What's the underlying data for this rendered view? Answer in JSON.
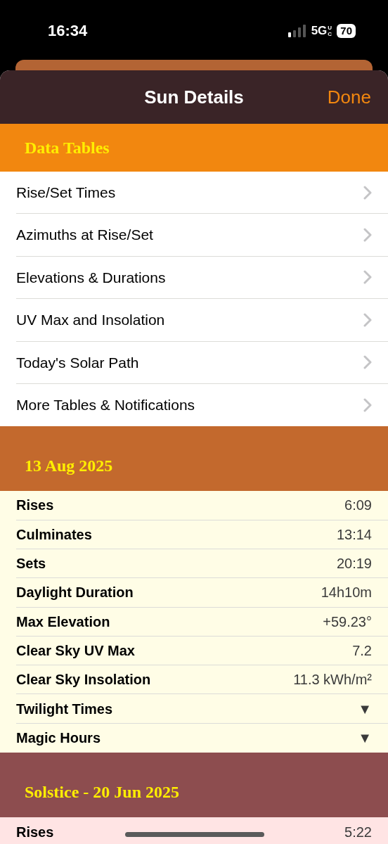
{
  "status_bar": {
    "time": "16:34",
    "network": "5G",
    "network_sub": "UC",
    "battery": "70"
  },
  "sheet": {
    "title": "Sun Details",
    "done_button": "Done"
  },
  "sections": [
    {
      "kind": "links",
      "title": "Data Tables",
      "rows": [
        {
          "label": "Rise/Set Times"
        },
        {
          "label": "Azimuths at Rise/Set"
        },
        {
          "label": "Elevations & Durations"
        },
        {
          "label": "UV Max and Insolation"
        },
        {
          "label": "Today's Solar Path"
        },
        {
          "label": "More Tables & Notifications"
        }
      ]
    },
    {
      "kind": "today",
      "title": "13 Aug 2025",
      "rows": [
        {
          "label": "Rises",
          "value": "6:09"
        },
        {
          "label": "Culminates",
          "value": "13:14"
        },
        {
          "label": "Sets",
          "value": "20:19"
        },
        {
          "label": "Daylight Duration",
          "value": "14h10m"
        },
        {
          "label": "Max Elevation",
          "value": "+59.23°"
        },
        {
          "label": "Clear Sky UV Max",
          "value": "7.2"
        },
        {
          "label": "Clear Sky Insolation",
          "value": "11.3 kWh/m²"
        },
        {
          "label": "Twilight Times",
          "value": "▼"
        },
        {
          "label": "Magic Hours",
          "value": "▼"
        }
      ]
    },
    {
      "kind": "solstice",
      "title": "Solstice - 20 Jun 2025",
      "rows": [
        {
          "label": "Rises",
          "value": "5:22"
        }
      ]
    }
  ]
}
